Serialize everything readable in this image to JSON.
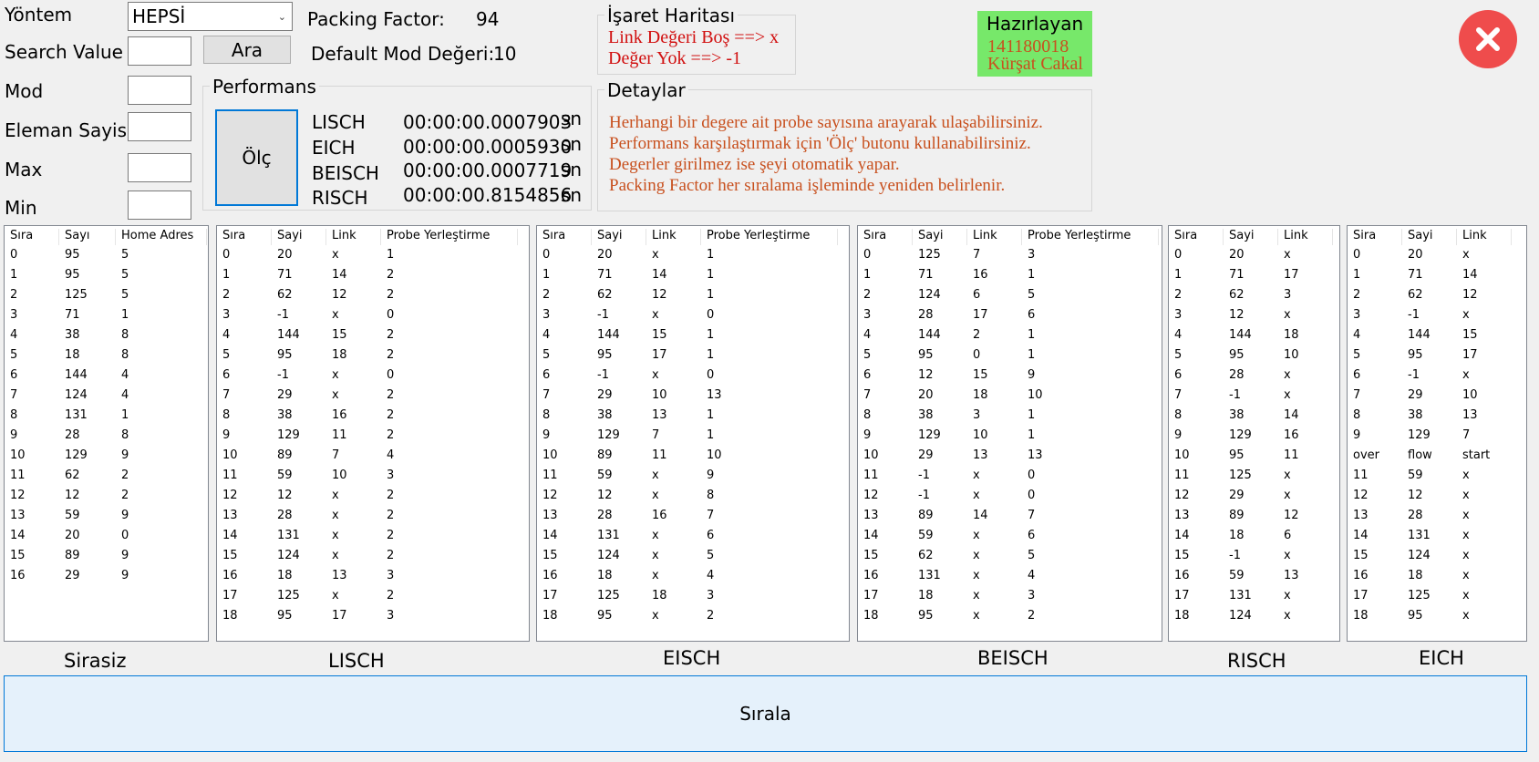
{
  "form": {
    "yontem_label": "Yöntem",
    "yontem_value": "HEPSİ",
    "search_label": "Search Value",
    "search_value": "",
    "ara_button": "Ara",
    "mod_label": "Mod",
    "mod_value": "",
    "eleman_label": "Eleman Sayisi",
    "eleman_value": "",
    "max_label": "Max",
    "max_value": "",
    "min_label": "Min",
    "min_value": "",
    "packing_label": "Packing Factor:",
    "packing_value": "94",
    "default_mod_label": "Default Mod Değeri:",
    "default_mod_value": "10"
  },
  "legend": {
    "title": "İşaret Haritası",
    "line1": "Link Değeri Boş ==> x",
    "line2": "Değer Yok ==> -1"
  },
  "author": {
    "title": "Hazırlayan",
    "id": "141180018",
    "name": "Kürşat Cakal",
    "bg_color": "#77e86a"
  },
  "performance": {
    "title": "Performans",
    "button": "Ölç",
    "rows": [
      {
        "name": "LISCH",
        "time": "00:00:00.0007903",
        "unit": "sn"
      },
      {
        "name": "EICH",
        "time": "00:00:00.0005930",
        "unit": "sn"
      },
      {
        "name": "BEISCH",
        "time": "00:00:00.0007719",
        "unit": "sn"
      },
      {
        "name": "RISCH",
        "time": "00:00:00.8154856",
        "unit": "sn"
      }
    ]
  },
  "details": {
    "title": "Detaylar",
    "lines": [
      "Herhangi bir degere ait probe sayısına arayarak ulaşabilirsiniz.",
      "Performans karşılaştırmak için  'Ölç'  butonu kullanabilirsiniz.",
      "Degerler girilmez ise şeyi otomatik yapar.",
      "Packing Factor her sıralama işleminde yeniden belirlenir."
    ]
  },
  "close_button_color": "#ef4c4c",
  "tables": [
    {
      "caption": "Sirasiz",
      "columns": [
        "Sıra",
        "Sayı",
        "Home Adres"
      ],
      "rows": [
        [
          "0",
          "95",
          "5"
        ],
        [
          "1",
          "95",
          "5"
        ],
        [
          "2",
          "125",
          "5"
        ],
        [
          "3",
          "71",
          "1"
        ],
        [
          "4",
          "38",
          "8"
        ],
        [
          "5",
          "18",
          "8"
        ],
        [
          "6",
          "144",
          "4"
        ],
        [
          "7",
          "124",
          "4"
        ],
        [
          "8",
          "131",
          "1"
        ],
        [
          "9",
          "28",
          "8"
        ],
        [
          "10",
          "129",
          "9"
        ],
        [
          "11",
          "62",
          "2"
        ],
        [
          "12",
          "12",
          "2"
        ],
        [
          "13",
          "59",
          "9"
        ],
        [
          "14",
          "20",
          "0"
        ],
        [
          "15",
          "89",
          "9"
        ],
        [
          "16",
          "29",
          "9"
        ]
      ]
    },
    {
      "caption": "LISCH",
      "columns": [
        "Sıra",
        "Sayi",
        "Link",
        "Probe Yerleştirme"
      ],
      "rows": [
        [
          "0",
          "20",
          "x",
          "1"
        ],
        [
          "1",
          "71",
          "14",
          "2"
        ],
        [
          "2",
          "62",
          "12",
          "2"
        ],
        [
          "3",
          "-1",
          "x",
          "0"
        ],
        [
          "4",
          "144",
          "15",
          "2"
        ],
        [
          "5",
          "95",
          "18",
          "2"
        ],
        [
          "6",
          "-1",
          "x",
          "0"
        ],
        [
          "7",
          "29",
          "x",
          "2"
        ],
        [
          "8",
          "38",
          "16",
          "2"
        ],
        [
          "9",
          "129",
          "11",
          "2"
        ],
        [
          "10",
          "89",
          "7",
          "4"
        ],
        [
          "11",
          "59",
          "10",
          "3"
        ],
        [
          "12",
          "12",
          "x",
          "2"
        ],
        [
          "13",
          "28",
          "x",
          "2"
        ],
        [
          "14",
          "131",
          "x",
          "2"
        ],
        [
          "15",
          "124",
          "x",
          "2"
        ],
        [
          "16",
          "18",
          "13",
          "3"
        ],
        [
          "17",
          "125",
          "x",
          "2"
        ],
        [
          "18",
          "95",
          "17",
          "3"
        ]
      ]
    },
    {
      "caption": "EISCH",
      "columns": [
        "Sıra",
        "Sayi",
        "Link",
        "Probe Yerleştirme"
      ],
      "rows": [
        [
          "0",
          "20",
          "x",
          "1"
        ],
        [
          "1",
          "71",
          "14",
          "1"
        ],
        [
          "2",
          "62",
          "12",
          "1"
        ],
        [
          "3",
          "-1",
          "x",
          "0"
        ],
        [
          "4",
          "144",
          "15",
          "1"
        ],
        [
          "5",
          "95",
          "17",
          "1"
        ],
        [
          "6",
          "-1",
          "x",
          "0"
        ],
        [
          "7",
          "29",
          "10",
          "13"
        ],
        [
          "8",
          "38",
          "13",
          "1"
        ],
        [
          "9",
          "129",
          "7",
          "1"
        ],
        [
          "10",
          "89",
          "11",
          "10"
        ],
        [
          "11",
          "59",
          "x",
          "9"
        ],
        [
          "12",
          "12",
          "x",
          "8"
        ],
        [
          "13",
          "28",
          "16",
          "7"
        ],
        [
          "14",
          "131",
          "x",
          "6"
        ],
        [
          "15",
          "124",
          "x",
          "5"
        ],
        [
          "16",
          "18",
          "x",
          "4"
        ],
        [
          "17",
          "125",
          "18",
          "3"
        ],
        [
          "18",
          "95",
          "x",
          "2"
        ]
      ]
    },
    {
      "caption": "BEISCH",
      "columns": [
        "Sıra",
        "Sayi",
        "Link",
        "Probe Yerleştirme"
      ],
      "rows": [
        [
          "0",
          "125",
          "7",
          "3"
        ],
        [
          "1",
          "71",
          "16",
          "1"
        ],
        [
          "2",
          "124",
          "6",
          "5"
        ],
        [
          "3",
          "28",
          "17",
          "6"
        ],
        [
          "4",
          "144",
          "2",
          "1"
        ],
        [
          "5",
          "95",
          "0",
          "1"
        ],
        [
          "6",
          "12",
          "15",
          "9"
        ],
        [
          "7",
          "20",
          "18",
          "10"
        ],
        [
          "8",
          "38",
          "3",
          "1"
        ],
        [
          "9",
          "129",
          "10",
          "1"
        ],
        [
          "10",
          "29",
          "13",
          "13"
        ],
        [
          "11",
          "-1",
          "x",
          "0"
        ],
        [
          "12",
          "-1",
          "x",
          "0"
        ],
        [
          "13",
          "89",
          "14",
          "7"
        ],
        [
          "14",
          "59",
          "x",
          "6"
        ],
        [
          "15",
          "62",
          "x",
          "5"
        ],
        [
          "16",
          "131",
          "x",
          "4"
        ],
        [
          "17",
          "18",
          "x",
          "3"
        ],
        [
          "18",
          "95",
          "x",
          "2"
        ]
      ]
    },
    {
      "caption": "RISCH",
      "columns": [
        "Sıra",
        "Sayi",
        "Link"
      ],
      "rows": [
        [
          "0",
          "20",
          "x"
        ],
        [
          "1",
          "71",
          "17"
        ],
        [
          "2",
          "62",
          "3"
        ],
        [
          "3",
          "12",
          "x"
        ],
        [
          "4",
          "144",
          "18"
        ],
        [
          "5",
          "95",
          "10"
        ],
        [
          "6",
          "28",
          "x"
        ],
        [
          "7",
          "-1",
          "x"
        ],
        [
          "8",
          "38",
          "14"
        ],
        [
          "9",
          "129",
          "16"
        ],
        [
          "10",
          "95",
          "11"
        ],
        [
          "11",
          "125",
          "x"
        ],
        [
          "12",
          "29",
          "x"
        ],
        [
          "13",
          "89",
          "12"
        ],
        [
          "14",
          "18",
          "6"
        ],
        [
          "15",
          "-1",
          "x"
        ],
        [
          "16",
          "59",
          "13"
        ],
        [
          "17",
          "131",
          "x"
        ],
        [
          "18",
          "124",
          "x"
        ]
      ]
    },
    {
      "caption": "EICH",
      "columns": [
        "Sira",
        "Sayi",
        "Link"
      ],
      "rows": [
        [
          "0",
          "20",
          "x"
        ],
        [
          "1",
          "71",
          "14"
        ],
        [
          "2",
          "62",
          "12"
        ],
        [
          "3",
          "-1",
          "x"
        ],
        [
          "4",
          "144",
          "15"
        ],
        [
          "5",
          "95",
          "17"
        ],
        [
          "6",
          "-1",
          "x"
        ],
        [
          "7",
          "29",
          "10"
        ],
        [
          "8",
          "38",
          "13"
        ],
        [
          "9",
          "129",
          "7"
        ],
        [
          "over",
          "flow",
          "start"
        ],
        [
          "11",
          "59",
          "x"
        ],
        [
          "12",
          "12",
          "x"
        ],
        [
          "13",
          "28",
          "x"
        ],
        [
          "14",
          "131",
          "x"
        ],
        [
          "15",
          "124",
          "x"
        ],
        [
          "16",
          "18",
          "x"
        ],
        [
          "17",
          "125",
          "x"
        ],
        [
          "18",
          "95",
          "x"
        ]
      ]
    }
  ],
  "sort_button": "Sırala"
}
